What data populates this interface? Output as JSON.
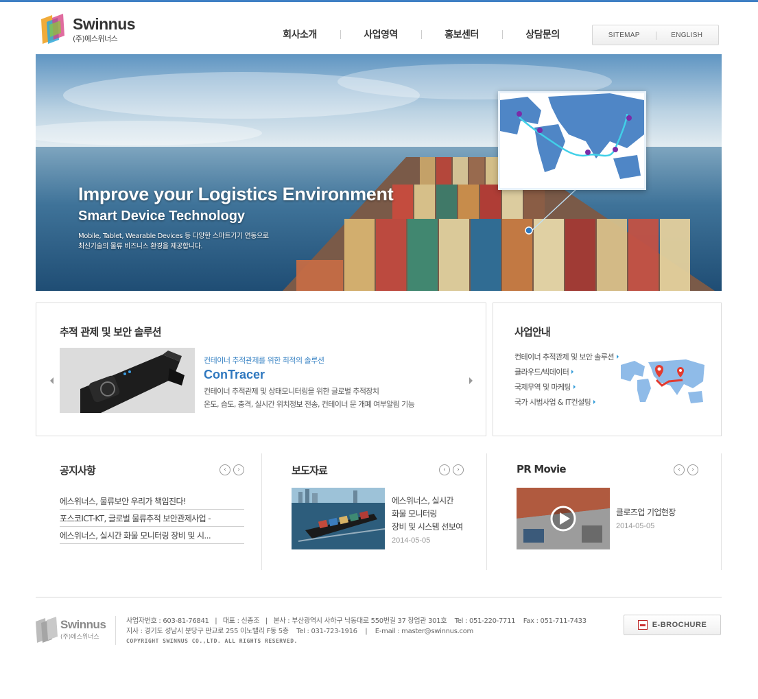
{
  "header": {
    "logo_word": "Swinnus",
    "logo_sub": "(주)에스위너스",
    "nav": [
      "회사소개",
      "사업영역",
      "홍보센터",
      "상담문의"
    ],
    "util": [
      "SITEMAP",
      "ENGLISH"
    ]
  },
  "hero": {
    "headline": "Improve your  Logistics Environment",
    "subheadline": "Smart Device  Technology",
    "line1": "Mobile, Tablet, Wearable Devices 등 다양한 스마트기기 연동으로",
    "line2": "최신기술의 물류 비즈니스 환경을 제공합니다."
  },
  "product": {
    "title": "추적 관제 및 보안 솔루션",
    "subtitle": "컨테이너 추적관제를 위한 최적의 솔루션",
    "name": "ConTracer",
    "desc1": "컨테이너 추적관제 및 상태모니터링을 위한 글로벌 추적장치",
    "desc2": "온도, 습도, 충격, 실시간 위치정보 전송, 컨테이너 문 개폐 여부알림 기능"
  },
  "business": {
    "title": "사업안내",
    "items": [
      "컨테이너 추적관제 및 보안 솔루션",
      "클라우드/빅데이터",
      "국제무역 및 마케팅",
      "국가 시범사업 & IT컨설팅"
    ]
  },
  "notice": {
    "title": "공지사항",
    "items": [
      "에스위너스, 물류보안 우리가 책임진다!",
      "포스코ICT-KT, 글로벌 물류추적 보안관제사업 -",
      "에스위너스, 실시간 화물 모니터링 장비 및 시..."
    ]
  },
  "press": {
    "title": "보도자료",
    "line1": "에스위너스, 실시간",
    "line2": "화물 모니터링",
    "line3": "장비 및 시스템 선보여",
    "date": "2014-05-05"
  },
  "movie": {
    "title": "PR Movie",
    "item_title": "클로즈업 기업현장",
    "date": "2014-05-05"
  },
  "footer": {
    "logo_word": "Swinnus",
    "logo_sub": "(주)에스위너스",
    "line1": "사업자번호 : 603-81-76841   |   대표 : 신종조   |   본사 : 부산광역시 사하구 낙동대로 550번길 37 창업관 301호    Tel : 051-220-7711    Fax : 051-711-7433",
    "line2": "지사 : 경기도 성남시 분당구 판교로 255 이노밸리 F동 5층    Tel : 031-723-1916    |    E-mail : master@swinnus.com",
    "copyright": "COPYRIGHT SWINNUS CO.,LTD. ALL RIGHTS RESERVED.",
    "ebrochure": "E-BROCHURE"
  },
  "colors": {
    "accent": "#3f7fc4",
    "product_name": "#2f78bf",
    "bullet": "#2f9ad8"
  }
}
